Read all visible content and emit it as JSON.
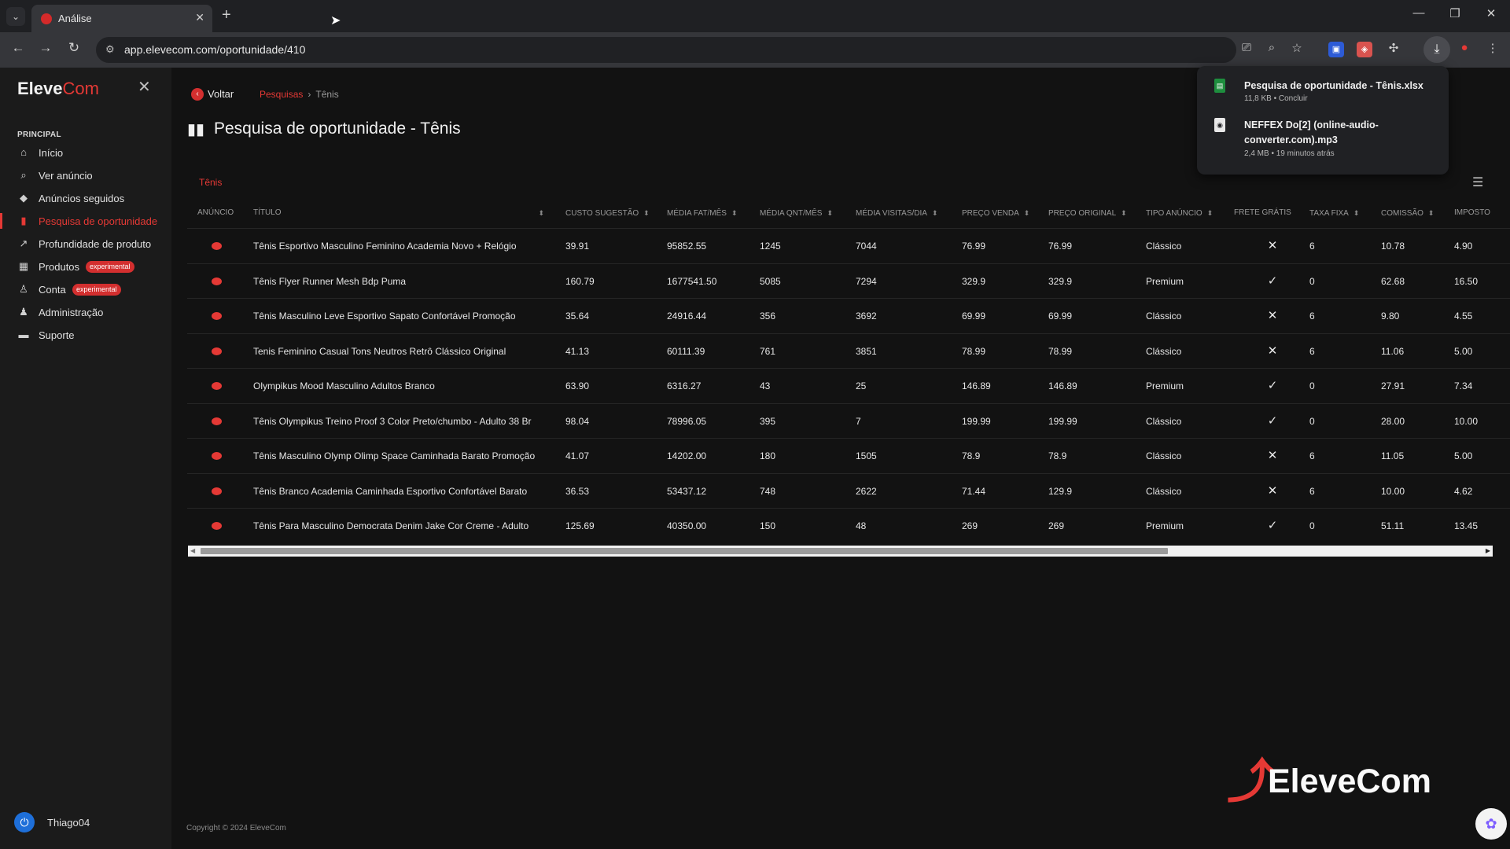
{
  "browser": {
    "tab_title": "Análise",
    "url": "app.elevecom.com/oportunidade/410"
  },
  "downloads": [
    {
      "name": "Pesquisa de oportunidade - Tênis.xlsx",
      "meta": "11,8 KB • Concluir",
      "icon": "spreadsheet-icon",
      "color": "#1e8e3e"
    },
    {
      "name": "NEFFEX Do[2] (online-audio-converter.com).mp3",
      "meta": "2,4 MB • 19 minutos atrás",
      "icon": "audio-file-icon",
      "color": "#e8e8e8"
    }
  ],
  "sidebar": {
    "brand_main": "Eleve",
    "brand_accent": "Com",
    "section": "PRINCIPAL",
    "items": [
      {
        "label": "Início",
        "icon": "home-icon"
      },
      {
        "label": "Ver anúncio",
        "icon": "search-icon"
      },
      {
        "label": "Anúncios seguidos",
        "icon": "tag-icon"
      },
      {
        "label": "Pesquisa de oportunidade",
        "icon": "bar-chart-icon"
      },
      {
        "label": "Profundidade de produto",
        "icon": "trend-icon"
      },
      {
        "label": "Produtos",
        "icon": "box-icon",
        "badge": "experimental"
      },
      {
        "label": "Conta",
        "icon": "user-icon",
        "badge": "experimental"
      },
      {
        "label": "Administração",
        "icon": "admin-icon"
      },
      {
        "label": "Suporte",
        "icon": "chat-icon"
      }
    ],
    "user": "Thiago04"
  },
  "header": {
    "back_label": "Voltar",
    "breadcrumb_link": "Pesquisas",
    "breadcrumb_sep": "›",
    "breadcrumb_current": "Tênis",
    "page_title": "Pesquisa de oportunidade - Tênis",
    "chip": "Tênis"
  },
  "table": {
    "columns": [
      "ANÚNCIO",
      "TÍTULO",
      "CUSTO SUGESTÃO",
      "MÉDIA FAT/MÊS",
      "MÉDIA QNT/MÊS",
      "MÉDIA VISITAS/DIA",
      "PREÇO VENDA",
      "PREÇO ORIGINAL",
      "TIPO ANÚNCIO",
      "FRETE GRÁTIS",
      "TAXA FIXA",
      "COMISSÃO",
      "IMPOSTO"
    ],
    "rows": [
      {
        "titulo": "Tênis Esportivo Masculino Feminino Academia Novo + Relógio",
        "custo": "39.91",
        "fat": "95852.55",
        "qnt": "1245",
        "visitas": "7044",
        "venda": "76.99",
        "original": "76.99",
        "tipo": "Clássico",
        "frete": "✕",
        "taxa": "6",
        "comissao": "10.78",
        "imposto": "4.90"
      },
      {
        "titulo": "Tênis Flyer Runner Mesh Bdp Puma",
        "custo": "160.79",
        "fat": "1677541.50",
        "qnt": "5085",
        "visitas": "7294",
        "venda": "329.9",
        "original": "329.9",
        "tipo": "Premium",
        "frete": "✓",
        "taxa": "0",
        "comissao": "62.68",
        "imposto": "16.50"
      },
      {
        "titulo": "Tênis Masculino Leve Esportivo Sapato Confortável Promoção",
        "custo": "35.64",
        "fat": "24916.44",
        "qnt": "356",
        "visitas": "3692",
        "venda": "69.99",
        "original": "69.99",
        "tipo": "Clássico",
        "frete": "✕",
        "taxa": "6",
        "comissao": "9.80",
        "imposto": "4.55"
      },
      {
        "titulo": "Tenis Feminino Casual Tons Neutros Retrô Clássico Original",
        "custo": "41.13",
        "fat": "60111.39",
        "qnt": "761",
        "visitas": "3851",
        "venda": "78.99",
        "original": "78.99",
        "tipo": "Clássico",
        "frete": "✕",
        "taxa": "6",
        "comissao": "11.06",
        "imposto": "5.00"
      },
      {
        "titulo": "Olympikus Mood Masculino Adultos Branco",
        "custo": "63.90",
        "fat": "6316.27",
        "qnt": "43",
        "visitas": "25",
        "venda": "146.89",
        "original": "146.89",
        "tipo": "Premium",
        "frete": "✓",
        "taxa": "0",
        "comissao": "27.91",
        "imposto": "7.34"
      },
      {
        "titulo": "Tênis Olympikus Treino Proof 3 Color Preto/chumbo - Adulto 38 Br",
        "custo": "98.04",
        "fat": "78996.05",
        "qnt": "395",
        "visitas": "7",
        "venda": "199.99",
        "original": "199.99",
        "tipo": "Clássico",
        "frete": "✓",
        "taxa": "0",
        "comissao": "28.00",
        "imposto": "10.00"
      },
      {
        "titulo": "Tênis Masculino Olymp Olimp Space Caminhada Barato Promoção",
        "custo": "41.07",
        "fat": "14202.00",
        "qnt": "180",
        "visitas": "1505",
        "venda": "78.9",
        "original": "78.9",
        "tipo": "Clássico",
        "frete": "✕",
        "taxa": "6",
        "comissao": "11.05",
        "imposto": "5.00"
      },
      {
        "titulo": "Tênis Branco Academia Caminhada Esportivo Confortável Barato",
        "custo": "36.53",
        "fat": "53437.12",
        "qnt": "748",
        "visitas": "2622",
        "venda": "71.44",
        "original": "129.9",
        "tipo": "Clássico",
        "frete": "✕",
        "taxa": "6",
        "comissao": "10.00",
        "imposto": "4.62"
      },
      {
        "titulo": "Tênis Para Masculino Democrata Denim Jake Cor Creme - Adulto",
        "custo": "125.69",
        "fat": "40350.00",
        "qnt": "150",
        "visitas": "48",
        "venda": "269",
        "original": "269",
        "tipo": "Premium",
        "frete": "✓",
        "taxa": "0",
        "comissao": "51.11",
        "imposto": "13.45"
      }
    ]
  },
  "footer": "Copyright © 2024 EleveCom",
  "logo_text": "EleveCom",
  "colors": {
    "accent": "#e53935",
    "background": "#121212",
    "sidebar": "#1b1b1b"
  }
}
